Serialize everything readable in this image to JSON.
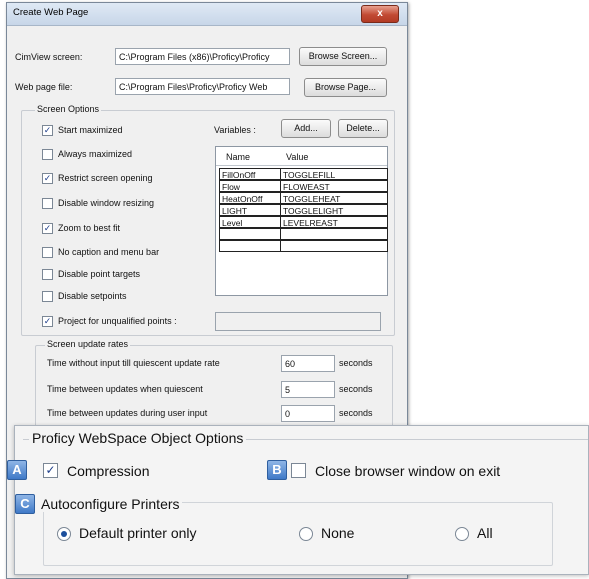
{
  "dialog": {
    "title": "Create Web Page",
    "close_label": "x",
    "cimview_label": "CimView screen:",
    "cimview_value": "C:\\Program Files (x86)\\Proficy\\Proficy",
    "browse_screen_label": "Browse Screen...",
    "webpage_label": "Web page file:",
    "webpage_value": "C:\\Program Files\\Proficy\\Proficy Web",
    "browse_page_label": "Browse Page..."
  },
  "screen_options": {
    "title": "Screen Options",
    "items": [
      {
        "label": "Start maximized",
        "checked": true
      },
      {
        "label": "Always maximized",
        "checked": false
      },
      {
        "label": "Restrict screen opening",
        "checked": true
      },
      {
        "label": "Disable window resizing",
        "checked": false
      },
      {
        "label": "Zoom to best fit",
        "checked": true
      },
      {
        "label": "No caption and menu bar",
        "checked": false
      },
      {
        "label": "Disable point targets",
        "checked": false
      },
      {
        "label": "Disable setpoints",
        "checked": false
      }
    ],
    "project_label": "Project for unqualified points :",
    "project_checked": true,
    "project_value": ""
  },
  "variables": {
    "label": "Variables :",
    "add_label": "Add...",
    "delete_label": "Delete...",
    "col_name": "Name",
    "col_value": "Value",
    "rows": [
      {
        "name": "FillOnOff",
        "value": "TOGGLEFILL"
      },
      {
        "name": "Flow",
        "value": "FLOWEAST"
      },
      {
        "name": "HeatOnOff",
        "value": "TOGGLEHEAT"
      },
      {
        "name": "LIGHT",
        "value": "TOGGLELIGHT"
      },
      {
        "name": "Level",
        "value": "LEVELREAST"
      },
      {
        "name": "",
        "value": ""
      },
      {
        "name": "",
        "value": ""
      }
    ]
  },
  "update_rates": {
    "title": "Screen update rates",
    "rows": [
      {
        "label": "Time without input till quiescent update rate",
        "value": "60",
        "unit": "seconds"
      },
      {
        "label": "Time between updates when quiescent",
        "value": "5",
        "unit": "seconds"
      },
      {
        "label": "Time between updates during user input",
        "value": "0",
        "unit": "seconds"
      }
    ]
  },
  "webspace": {
    "title": "Proficy WebSpace Object Options",
    "badge_a": "A",
    "compression_label": "Compression",
    "compression_checked": true,
    "badge_b": "B",
    "close_browser_label": "Close browser window on exit",
    "close_browser_checked": false,
    "badge_c": "C",
    "autoconfig_title": "Autoconfigure Printers",
    "printer_options": [
      {
        "label": "Default printer only",
        "selected": true
      },
      {
        "label": "None",
        "selected": false
      },
      {
        "label": "All",
        "selected": false
      }
    ]
  },
  "colors": {
    "badge": "#3f79c7",
    "close_button": "#c24a33",
    "check_mark": "#1e3e8a"
  }
}
